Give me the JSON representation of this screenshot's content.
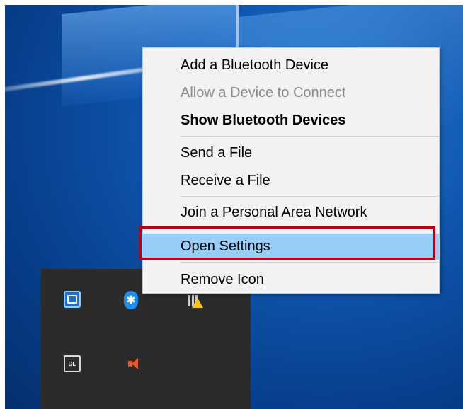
{
  "context_menu": {
    "items": [
      {
        "label": "Add a Bluetooth Device",
        "state": "normal"
      },
      {
        "label": "Allow a Device to Connect",
        "state": "disabled"
      },
      {
        "label": "Show Bluetooth Devices",
        "state": "default"
      },
      {
        "label": "Send a File",
        "state": "normal"
      },
      {
        "label": "Receive a File",
        "state": "normal"
      },
      {
        "label": "Join a Personal Area Network",
        "state": "normal"
      },
      {
        "label": "Open Settings",
        "state": "highlighted"
      },
      {
        "label": "Remove Icon",
        "state": "normal"
      }
    ]
  },
  "tray": {
    "icons": [
      "display-settings-icon",
      "bluetooth-icon",
      "network-warning-icon",
      "dl-device-icon",
      "speaker-icon"
    ]
  },
  "colors": {
    "highlight": "#99ccf7",
    "annotation_box": "#b3001b",
    "menu_background": "#f2f2f2",
    "tray_background": "#2b2b2b"
  }
}
